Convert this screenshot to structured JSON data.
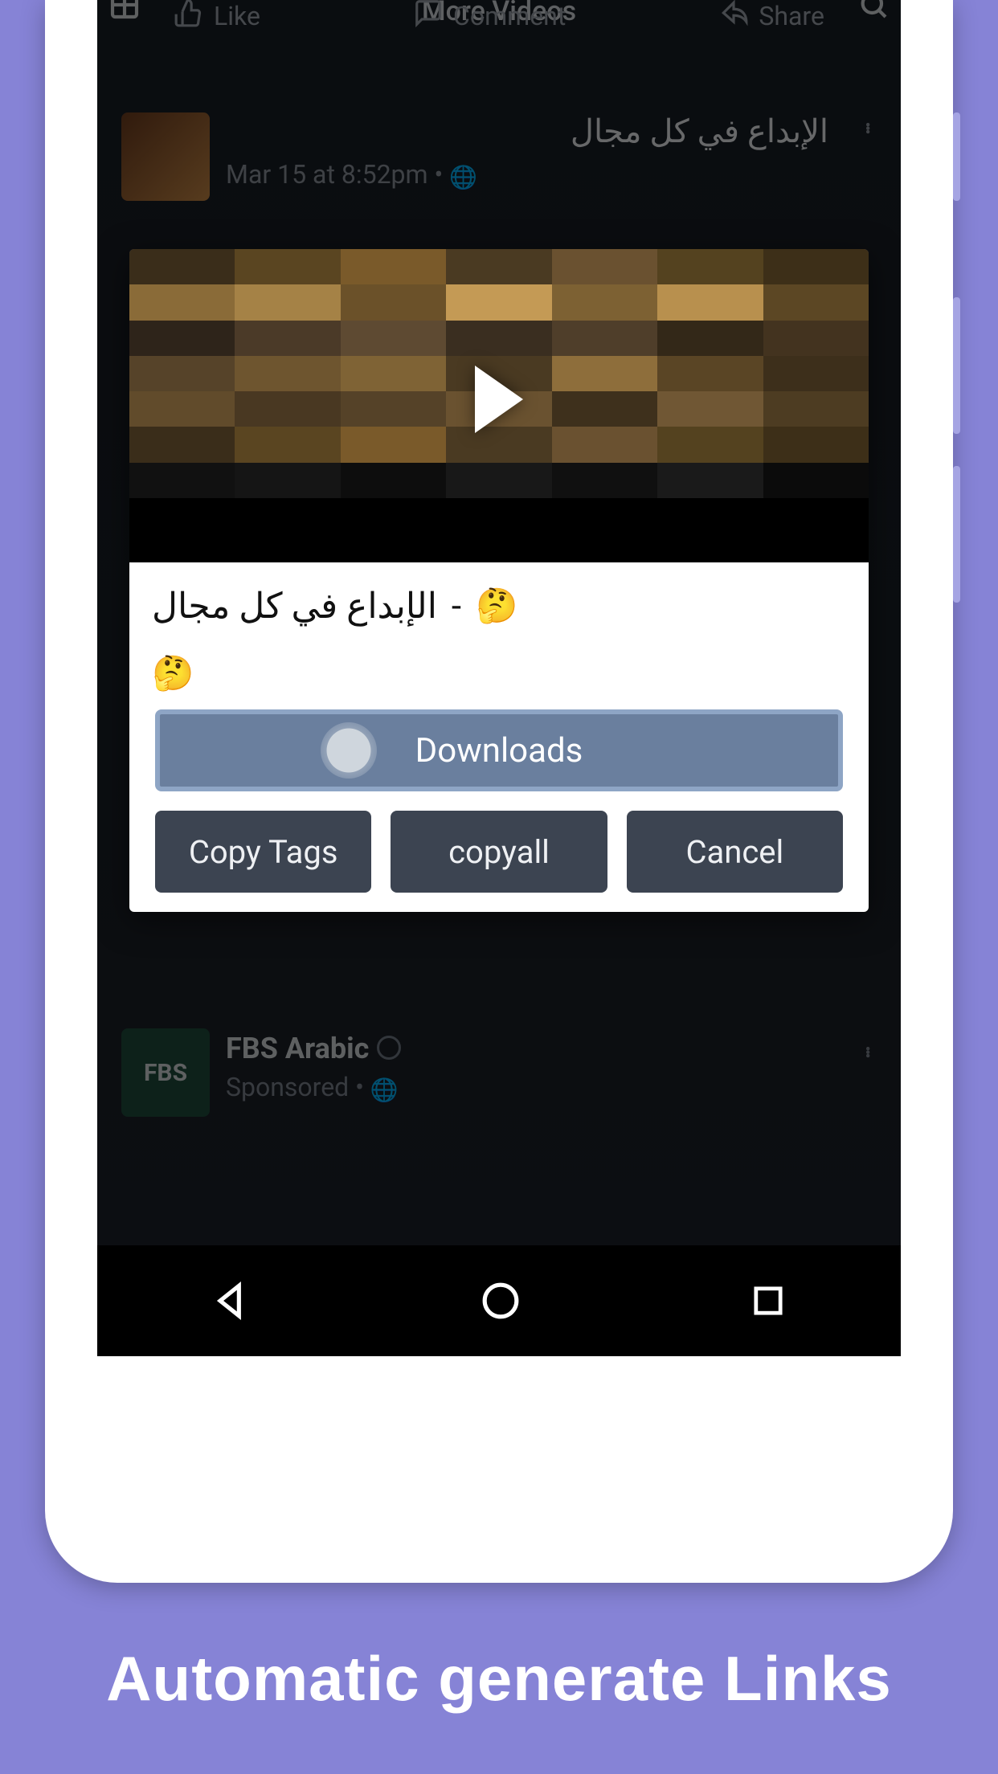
{
  "promo_text": "Automatic generate Links",
  "screen": {
    "header_title": "More Videos",
    "action_like": "Like",
    "action_comment": "Comment",
    "action_share": "Share"
  },
  "post1": {
    "name": "الإبداع في كل مجال",
    "timestamp": "Mar 15 at 8:52pm"
  },
  "post2": {
    "name": "FBS Arabic",
    "sponsored": "Sponsored",
    "avatar_text": "FBS"
  },
  "modal": {
    "caption_prefix": "🤔",
    "caption_text": "الإبداع في كل مجال",
    "caption_separator": " - ",
    "caption_suffix_emoji": "🤔",
    "downloads_label": "Downloads",
    "copy_tags_label": "Copy Tags",
    "copyall_label": "copyall",
    "cancel_label": "Cancel"
  }
}
